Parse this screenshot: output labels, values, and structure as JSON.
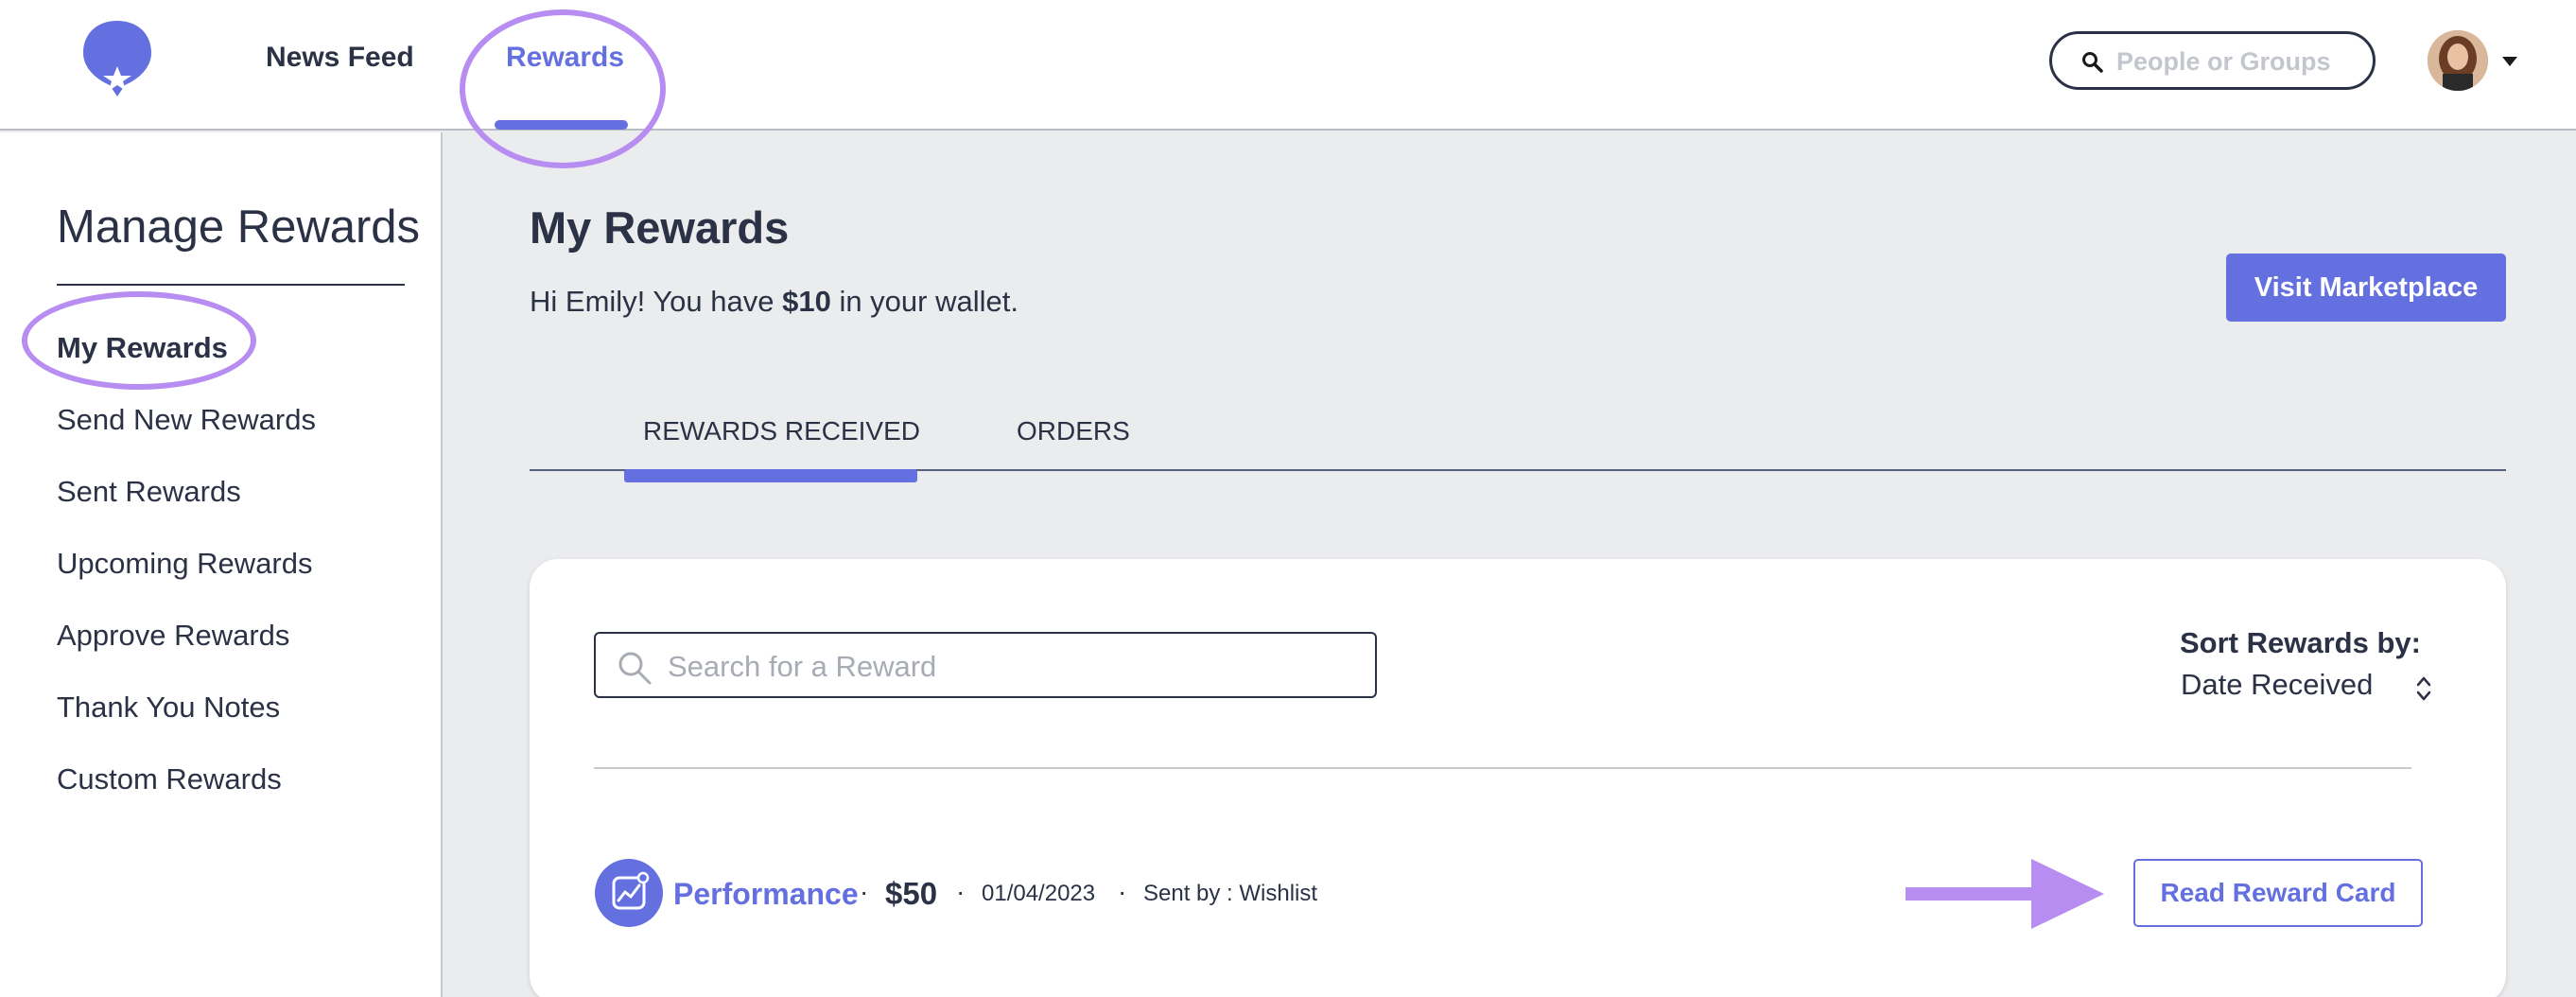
{
  "header": {
    "nav": [
      {
        "label": "News Feed"
      },
      {
        "label": "Rewards"
      }
    ],
    "people_search": {
      "placeholder": "People or Groups",
      "icon": "search-icon"
    },
    "avatar": {
      "icon": "user-avatar"
    },
    "accent_color": "#6470e0",
    "highlight_color": "#b78df2"
  },
  "sidebar": {
    "title": "Manage Rewards",
    "items": [
      {
        "label": "My Rewards"
      },
      {
        "label": "Send New Rewards"
      },
      {
        "label": "Sent Rewards"
      },
      {
        "label": "Upcoming Rewards"
      },
      {
        "label": "Approve Rewards"
      },
      {
        "label": "Thank You Notes"
      },
      {
        "label": "Custom Rewards"
      }
    ]
  },
  "main": {
    "title": "My Rewards",
    "wallet": {
      "prefix": "Hi Emily! You have ",
      "amount": "$10",
      "suffix": " in your wallet."
    },
    "visit_button": "Visit Marketplace",
    "tabs": [
      {
        "label": "REWARDS RECEIVED"
      },
      {
        "label": "ORDERS"
      }
    ],
    "reward_search": {
      "placeholder": "Search for a Reward"
    },
    "sort": {
      "label": "Sort Rewards by:",
      "value": "Date Received"
    },
    "rewards": [
      {
        "category": "Performance",
        "amount": "$50",
        "date": "01/04/2023",
        "sender": "Sent by : Wishlist",
        "action": "Read Reward Card",
        "icon": "chart-icon"
      }
    ],
    "separator": "·"
  }
}
